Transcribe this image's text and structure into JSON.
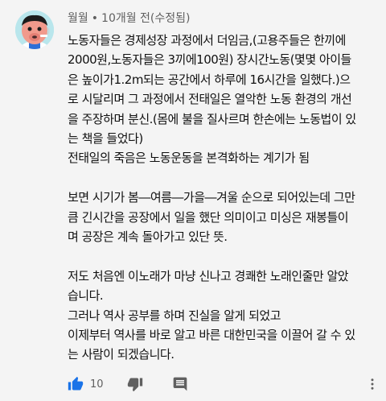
{
  "comment": {
    "author": "월월",
    "separator": "•",
    "time": "10개월 전(수정됨)",
    "lines": [
      [
        "노동자들은 경제성장 과정에서 더임금,(고용주들은 한끼에",
        "2000원,노동자들은 3끼에100원) 장시간노동(몇몇 아이들",
        "은 높이가1.2m되는 공간에서 하루에 16시간을 일했다.)으",
        "로 시달리며 그 과정에서 전태일은 열악한 노동 환경의 개선",
        "을 주장하며 분신.(몸에 불을 질사르며 한손에는 노동법이 있",
        "는 책을 들었다)",
        "전태일의 죽음은 노동운동을 본격화하는 계기가 됨"
      ],
      [
        "보면 시기가 봄―여름―가을―겨울 순으로 되어있는데 그만",
        "큼 긴시간을 공장에서 일을 했단 의미이고 미싱은 재봉틀이",
        "며 공장은 계속 돌아가고 있단 뜻."
      ],
      [
        "저도 처음엔 이노래가 마냥 신나고 경쾌한 노래인줄만 알았",
        "습니다.",
        "그러나 역사 공부를 하며 진실을 알게 되었고",
        "이제부터 역사를 바로 알고 바른 대한민국을 이끌어 갈 수 있",
        "는 사람이 되겠습니다."
      ]
    ],
    "like_count": "10"
  },
  "icons": {
    "like": "thumb-up-icon",
    "dislike": "thumb-down-icon",
    "reply": "reply-comment-icon",
    "more": "more-vertical-icon",
    "avatar": "avatar-character-icon"
  },
  "colors": {
    "background": "#f4f4f4",
    "like_active": "#1a73e8",
    "icon_gray": "#606060",
    "text": "#111111"
  }
}
